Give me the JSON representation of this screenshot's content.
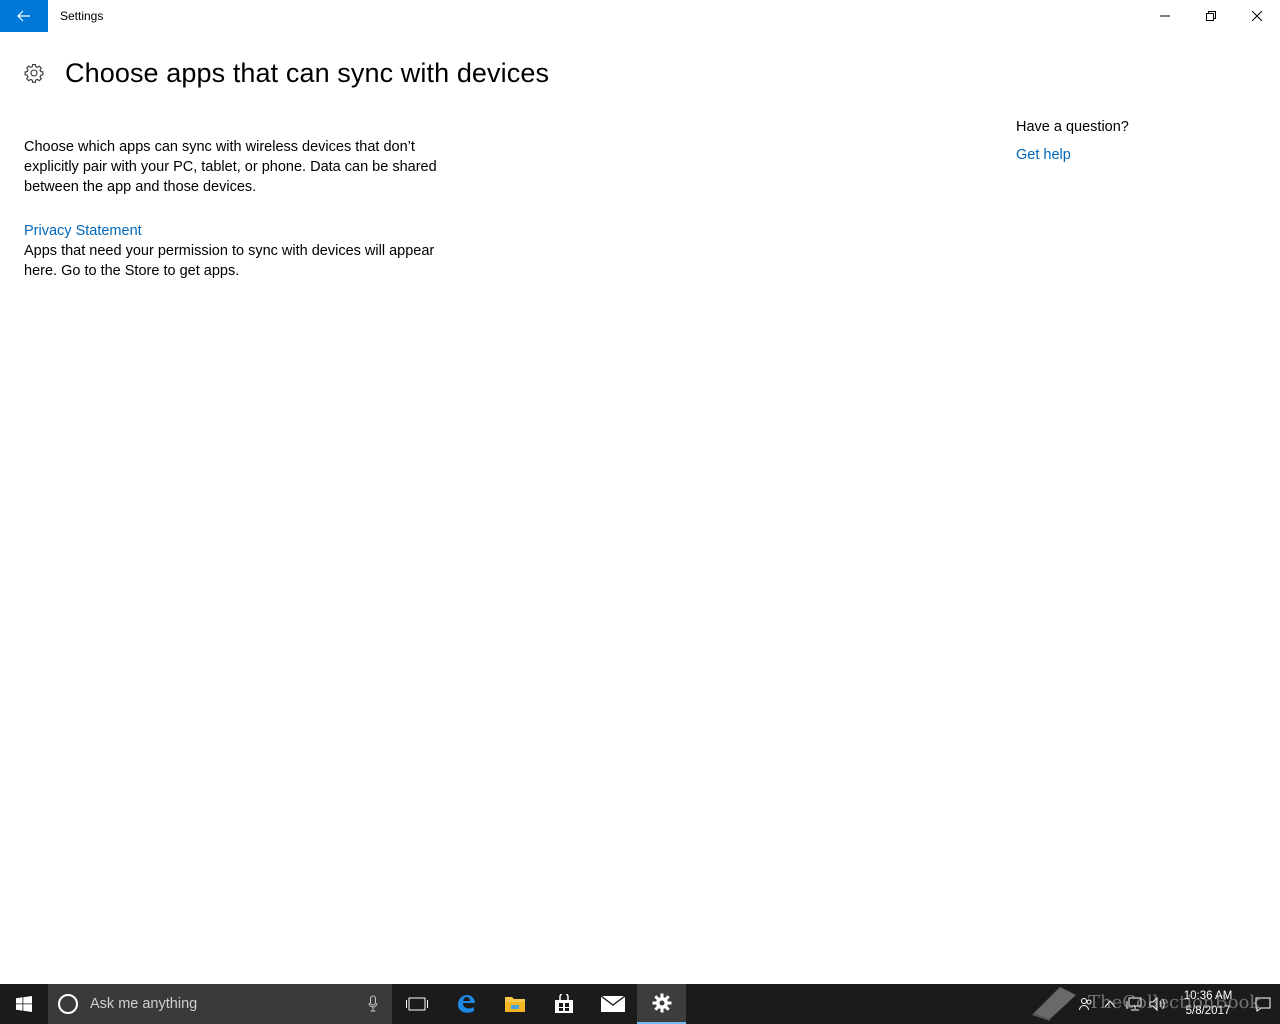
{
  "window": {
    "title": "Settings"
  },
  "header": {
    "title": "Choose apps that can sync with devices"
  },
  "main": {
    "description": "Choose which apps can sync with wireless devices that don’t explicitly pair with your PC, tablet, or phone. Data can be shared between the app and those devices.",
    "privacy_link": "Privacy Statement",
    "apps_note": "Apps that need your permission to sync with devices will appear here. Go to the Store to get apps."
  },
  "aside": {
    "question": "Have a question?",
    "help_link": "Get help"
  },
  "taskbar": {
    "search_placeholder": "Ask me anything",
    "pinned": [
      "task-view-icon",
      "edge-icon",
      "file-explorer-icon",
      "store-icon",
      "mail-icon",
      "settings-icon"
    ],
    "active_app": "settings-icon",
    "clock_time": "10:36 AM",
    "clock_date": "5/8/2017"
  },
  "watermark": {
    "text": "TheCollectionBook"
  },
  "colors": {
    "accent": "#0078d7",
    "link": "#0067b8",
    "taskbar": "#1b1b1b"
  }
}
